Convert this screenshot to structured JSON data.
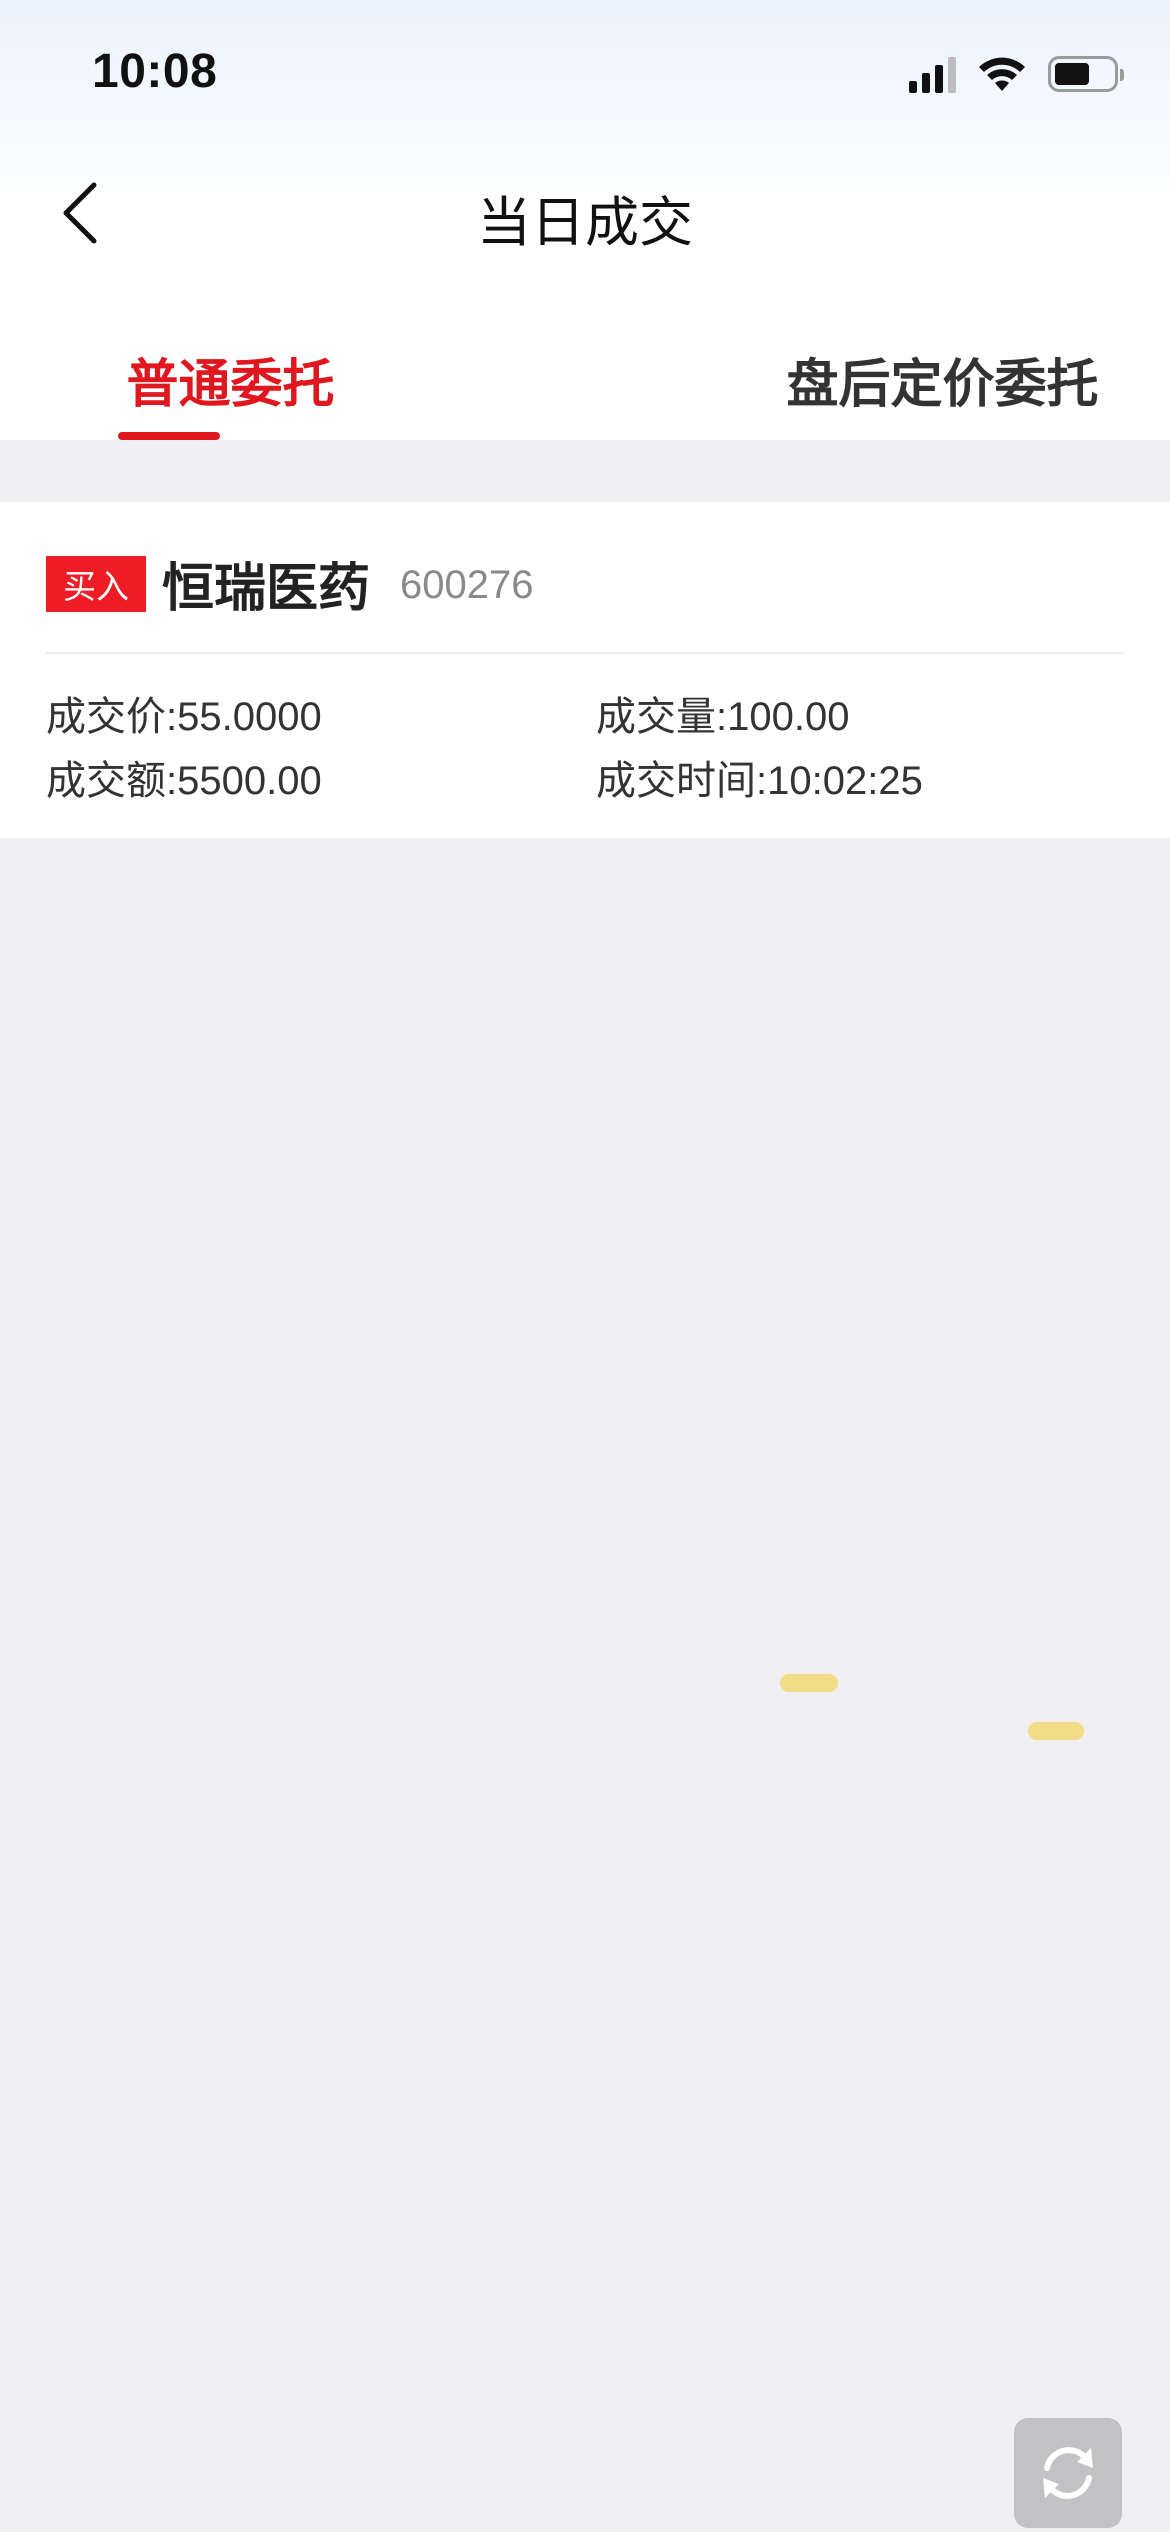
{
  "status_bar": {
    "time": "10:08",
    "icons": [
      "cellular-signal-icon",
      "wifi-icon",
      "battery-icon"
    ]
  },
  "nav": {
    "back_icon": "chevron-left-icon",
    "title": "当日成交"
  },
  "tabs": [
    {
      "label": "普通委托",
      "active": true
    },
    {
      "label": "盘后定价委托",
      "active": false
    }
  ],
  "colors": {
    "accent": "#e0171e",
    "buy_tag": "#ee1c25",
    "background": "#f0f0f2"
  },
  "trades": [
    {
      "side": "买入",
      "name": "恒瑞医药",
      "code": "600276",
      "price": "成交价:55.0000",
      "quantity": "成交量:100.00",
      "amount": "成交额:5500.00",
      "time": "成交时间:10:02:25"
    }
  ],
  "refresh_icon": "refresh-icon"
}
